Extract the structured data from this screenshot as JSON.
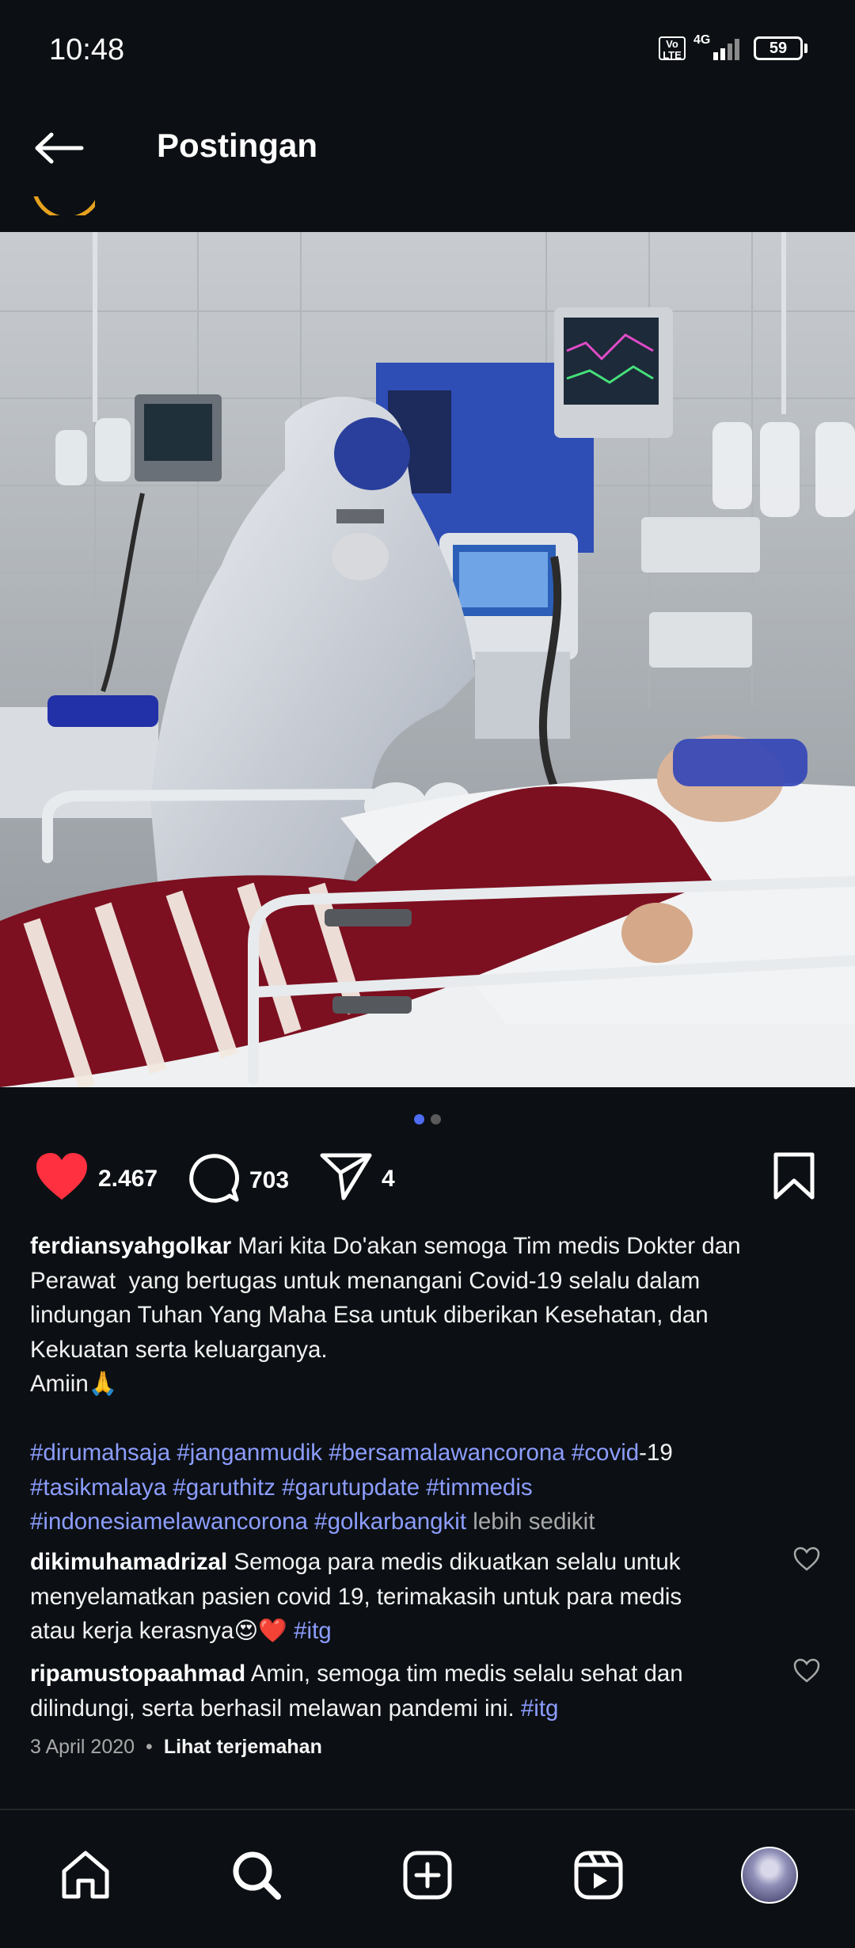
{
  "status": {
    "time": "10:48",
    "network": "4G",
    "volte": "Vo LTE",
    "battery": "59"
  },
  "header": {
    "title": "Postingan"
  },
  "post": {
    "image_alt": "ICU ward photo",
    "carousel": {
      "total": 2,
      "current": 1
    },
    "likes": "2.467",
    "comments": "703",
    "shares": "4",
    "caption": {
      "username": "ferdiansyahgolkar",
      "lines": [
        "Mari kita Do'akan semoga Tim medis Dokter dan",
        "Perawat  yang bertugas untuk menangani Covid-19 selalu dalam",
        "lindungan Tuhan Yang Maha Esa untuk diberikan Kesehatan, dan",
        "Kekuatan serta keluarganya.",
        "Amiin🙏"
      ],
      "hashtags": [
        "#dirumahsaja",
        "#janganmudik",
        "#bersamalawancorona",
        "#covid",
        "#tasikmalaya",
        "#garuthitz",
        "#garutupdate",
        "#timmedis",
        "#indonesiamelawancorona",
        "#golkarbangkit"
      ],
      "covid_suffix": "-19",
      "less": "lebih sedikit"
    },
    "comments_list": [
      {
        "username": "dikimuhamadrizal",
        "text1": "Semoga para medis dikuatkan selalu untuk",
        "text2": "menyelamatkan pasien covid 19, terimakasih untuk para medis",
        "text3": "atau kerja kerasnya😍❤️ ",
        "tag": "#itg"
      },
      {
        "username": "ripamustopaahmad",
        "text1": "Amin, semoga tim medis selalu sehat dan",
        "text2": "dilindungi, serta berhasil melawan pandemi ini. ",
        "tag": "#itg"
      }
    ],
    "date": "3 April 2020",
    "separator": "•",
    "translate": "Lihat terjemahan"
  },
  "colors": {
    "background": "#0c1014",
    "like": "#ff3040",
    "hashtag": "#8c9dff",
    "dot_active": "#4d6cf2"
  },
  "nav": {
    "items": [
      "home-icon",
      "search-icon",
      "create-icon",
      "reels-icon",
      "profile-avatar"
    ]
  }
}
